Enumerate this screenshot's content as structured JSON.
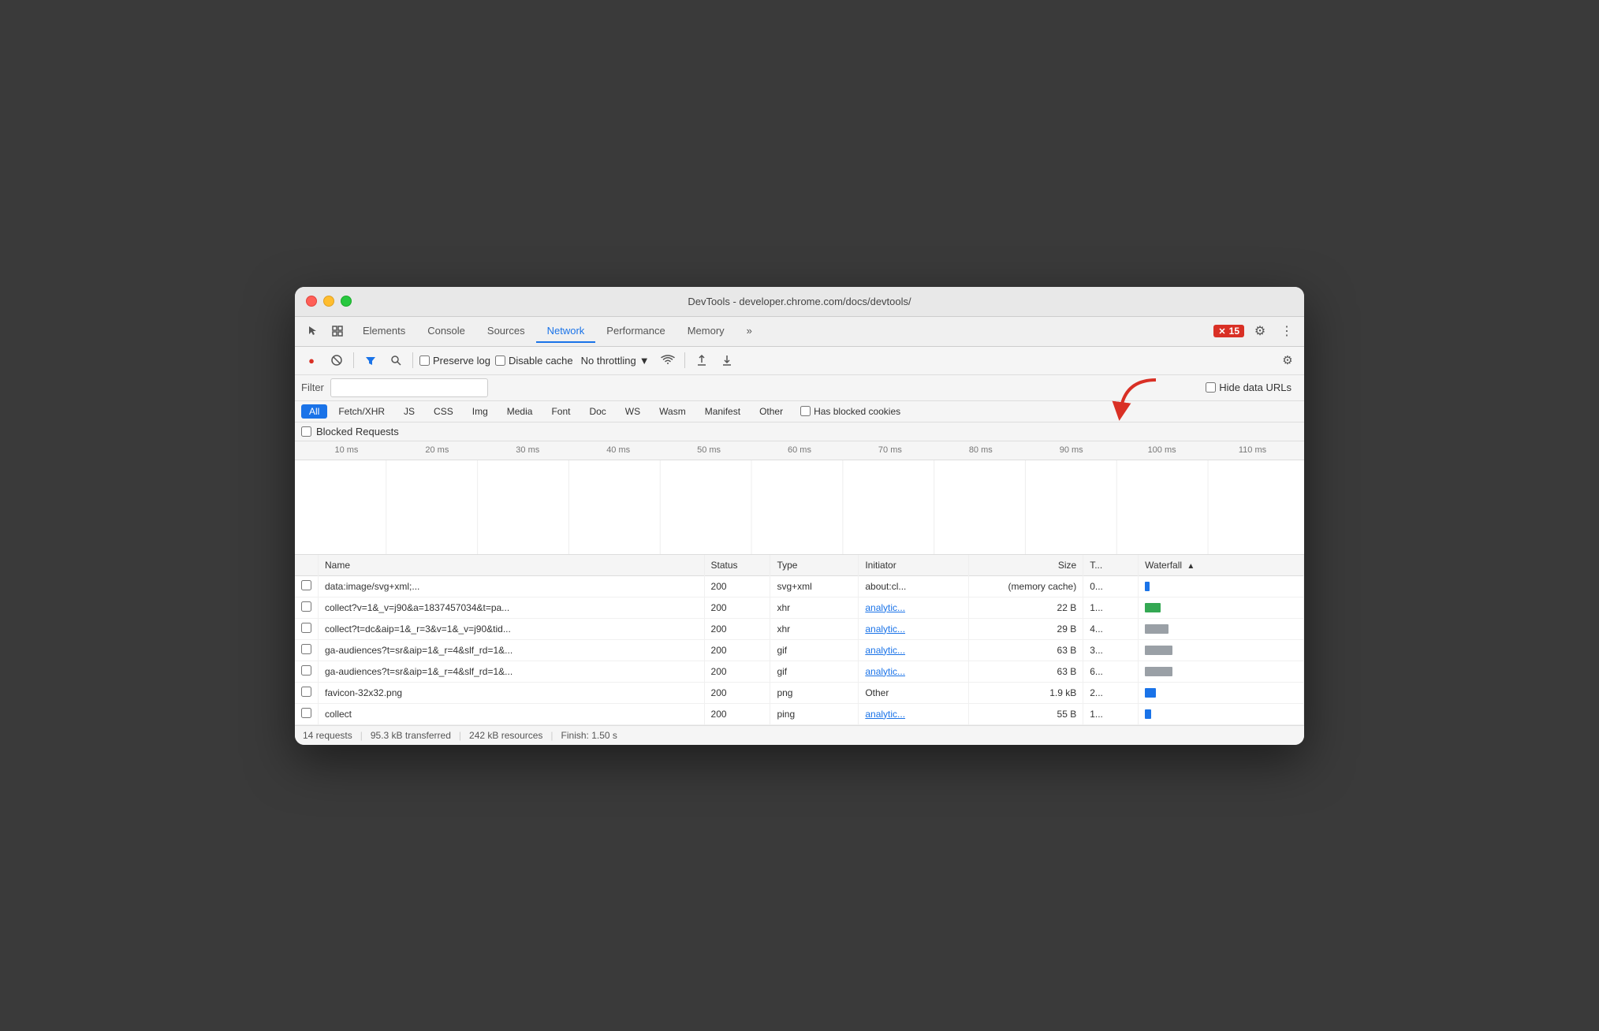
{
  "window": {
    "title": "DevTools - developer.chrome.com/docs/devtools/"
  },
  "titlebar": {
    "title": "DevTools - developer.chrome.com/docs/devtools/"
  },
  "nav": {
    "tabs": [
      {
        "label": "Elements",
        "active": false
      },
      {
        "label": "Console",
        "active": false
      },
      {
        "label": "Sources",
        "active": false
      },
      {
        "label": "Network",
        "active": true
      },
      {
        "label": "Performance",
        "active": false
      },
      {
        "label": "Memory",
        "active": false
      }
    ],
    "more_label": "»",
    "error_count": "15",
    "settings_icon": "⚙",
    "more_vert_icon": "⋮"
  },
  "toolbar": {
    "record_icon": "🔴",
    "clear_icon": "🚫",
    "filter_icon": "▽",
    "search_icon": "🔍",
    "preserve_log_label": "Preserve log",
    "disable_cache_label": "Disable cache",
    "throttle_label": "No throttling",
    "wifi_icon": "📶",
    "upload_icon": "⬆",
    "download_icon": "⬇",
    "settings_icon": "⚙"
  },
  "filter_bar": {
    "label": "Filter",
    "placeholder": "",
    "hide_data_urls_label": "Hide data URLs"
  },
  "type_filters": [
    {
      "label": "All",
      "active": true
    },
    {
      "label": "Fetch/XHR",
      "active": false
    },
    {
      "label": "JS",
      "active": false
    },
    {
      "label": "CSS",
      "active": false
    },
    {
      "label": "Img",
      "active": false
    },
    {
      "label": "Media",
      "active": false
    },
    {
      "label": "Font",
      "active": false
    },
    {
      "label": "Doc",
      "active": false
    },
    {
      "label": "WS",
      "active": false
    },
    {
      "label": "Wasm",
      "active": false
    },
    {
      "label": "Manifest",
      "active": false
    },
    {
      "label": "Other",
      "active": false
    }
  ],
  "has_blocked_cookies_label": "Has blocked cookies",
  "blocked_requests_label": "Blocked Requests",
  "timeline": {
    "ticks": [
      "10 ms",
      "20 ms",
      "30 ms",
      "40 ms",
      "50 ms",
      "60 ms",
      "70 ms",
      "80 ms",
      "90 ms",
      "100 ms",
      "110 ms"
    ]
  },
  "table": {
    "columns": [
      {
        "label": "Name"
      },
      {
        "label": "Status"
      },
      {
        "label": "Type"
      },
      {
        "label": "Initiator"
      },
      {
        "label": "Size"
      },
      {
        "label": "T..."
      },
      {
        "label": "Waterfall",
        "sort": "▲"
      }
    ],
    "rows": [
      {
        "checkbox": true,
        "name": "data:image/svg+xml;...",
        "status": "200",
        "type": "svg+xml",
        "initiator": "about:cl...",
        "size": "(memory cache)",
        "time": "0...",
        "waterfall_color": "blue",
        "waterfall_width": 6
      },
      {
        "checkbox": true,
        "name": "collect?v=1&_v=j90&a=1837457034&t=pa...",
        "status": "200",
        "type": "xhr",
        "initiator": "analytic...",
        "initiator_link": true,
        "size": "22 B",
        "time": "1...",
        "waterfall_color": "green",
        "waterfall_width": 20
      },
      {
        "checkbox": true,
        "name": "collect?t=dc&aip=1&_r=3&v=1&_v=j90&tid...",
        "status": "200",
        "type": "xhr",
        "initiator": "analytic...",
        "initiator_link": true,
        "size": "29 B",
        "time": "4...",
        "waterfall_color": "gray",
        "waterfall_width": 30
      },
      {
        "checkbox": true,
        "name": "ga-audiences?t=sr&aip=1&_r=4&slf_rd=1&...",
        "status": "200",
        "type": "gif",
        "initiator": "analytic...",
        "initiator_link": true,
        "size": "63 B",
        "time": "3...",
        "waterfall_color": "gray",
        "waterfall_width": 35
      },
      {
        "checkbox": true,
        "name": "ga-audiences?t=sr&aip=1&_r=4&slf_rd=1&...",
        "status": "200",
        "type": "gif",
        "initiator": "analytic...",
        "initiator_link": true,
        "size": "63 B",
        "time": "6...",
        "waterfall_color": "gray",
        "waterfall_width": 35
      },
      {
        "checkbox": true,
        "name": "favicon-32x32.png",
        "status": "200",
        "type": "png",
        "initiator": "Other",
        "initiator_link": false,
        "size": "1.9 kB",
        "time": "2...",
        "waterfall_color": "blue",
        "waterfall_width": 14
      },
      {
        "checkbox": true,
        "name": "collect",
        "status": "200",
        "type": "ping",
        "initiator": "analytic...",
        "initiator_link": true,
        "size": "55 B",
        "time": "1...",
        "waterfall_color": "blue",
        "waterfall_width": 8
      }
    ]
  },
  "status_bar": {
    "requests": "14 requests",
    "transferred": "95.3 kB transferred",
    "resources": "242 kB resources",
    "finish": "Finish: 1.50 s"
  }
}
